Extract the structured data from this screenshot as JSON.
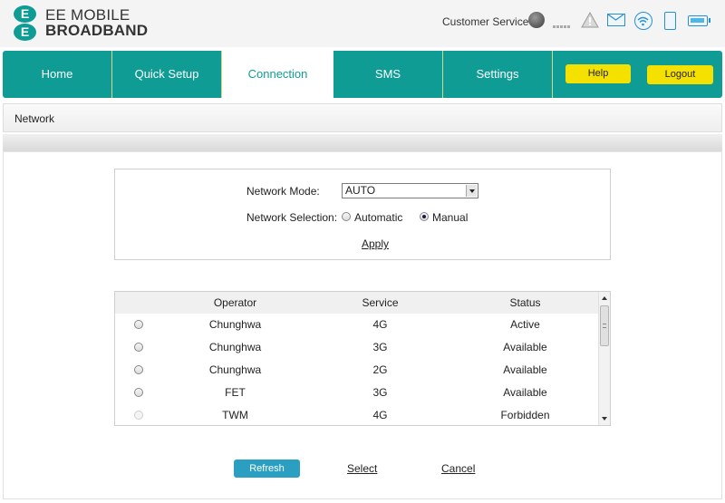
{
  "brand": {
    "line1": "EE MOBILE",
    "line2": "BROADBAND",
    "logo_letter": "E",
    "color": "#0f9c95"
  },
  "header": {
    "customer_service": "Customer Service",
    "icons": [
      "sim-status-icon",
      "signal-strength-icon",
      "warning-icon",
      "message-icon",
      "wifi-icon",
      "device-icon",
      "battery-icon"
    ]
  },
  "nav": {
    "tabs": [
      {
        "label": "Home"
      },
      {
        "label": "Quick Setup"
      },
      {
        "label": "Connection",
        "active": true
      },
      {
        "label": "SMS"
      },
      {
        "label": "Settings"
      }
    ],
    "help": "Help",
    "logout": "Logout",
    "button_color": "#f5e100"
  },
  "section": {
    "title": "Network"
  },
  "network": {
    "mode_label": "Network Mode:",
    "mode_value": "AUTO",
    "selection_label": "Network Selection:",
    "selection_options": [
      {
        "label": "Automatic",
        "selected": false
      },
      {
        "label": "Manual",
        "selected": true
      }
    ],
    "apply": "Apply"
  },
  "operators": {
    "headers": [
      "Operator",
      "Service",
      "Status"
    ],
    "rows": [
      {
        "operator": "Chunghwa",
        "service": "4G",
        "status": "Active",
        "disabled": false
      },
      {
        "operator": "Chunghwa",
        "service": "3G",
        "status": "Available",
        "disabled": false
      },
      {
        "operator": "Chunghwa",
        "service": "2G",
        "status": "Available",
        "disabled": false
      },
      {
        "operator": "FET",
        "service": "3G",
        "status": "Available",
        "disabled": false
      },
      {
        "operator": "TWM",
        "service": "4G",
        "status": "Forbidden",
        "disabled": true
      }
    ]
  },
  "actions": {
    "refresh": "Refresh",
    "select": "Select",
    "cancel": "Cancel",
    "refresh_color": "#2a9fc1"
  }
}
